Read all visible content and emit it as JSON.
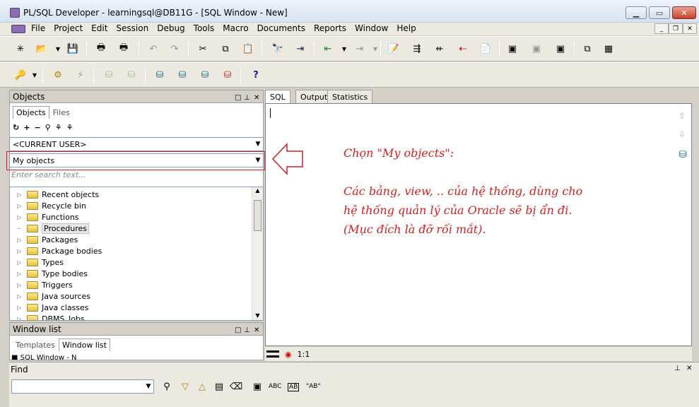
{
  "window": {
    "title": "PL/SQL Developer - learningsql@DB11G - [SQL Window - New]"
  },
  "menu": [
    "File",
    "Project",
    "Edit",
    "Session",
    "Debug",
    "Tools",
    "Macro",
    "Documents",
    "Reports",
    "Window",
    "Help"
  ],
  "objects_panel": {
    "title": "Objects",
    "tabs": [
      "Objects",
      "Files"
    ],
    "user_combo": "<CURRENT USER>",
    "filter_combo": "My objects",
    "search_placeholder": "Enter search text...",
    "tree": [
      "Recent objects",
      "Recycle bin",
      "Functions",
      "Procedures",
      "Packages",
      "Package bodies",
      "Types",
      "Type bodies",
      "Triggers",
      "Java sources",
      "Java classes",
      "DBMS_Jobs"
    ]
  },
  "window_list_panel": {
    "title": "Window list",
    "tabs": [
      "Templates",
      "Window list"
    ],
    "item": "SQL Window - N"
  },
  "editor": {
    "tabs": [
      "SQL",
      "Output",
      "Statistics"
    ],
    "annotation": "Chọn \"My objects\":\n\nCác bảng, view, .. của hệ thống, dùng cho\nhệ thống quản lý của Oracle sẽ bị ẩn đi.\n(Mục đích là đỡ rối mắt).",
    "status_position": "1:1"
  },
  "find_bar": {
    "title": "Find",
    "labels": [
      "ABC",
      "AB",
      "\"AB\""
    ]
  },
  "colors": {
    "annotation": "#d02020",
    "highlight_box": "#d02020"
  }
}
